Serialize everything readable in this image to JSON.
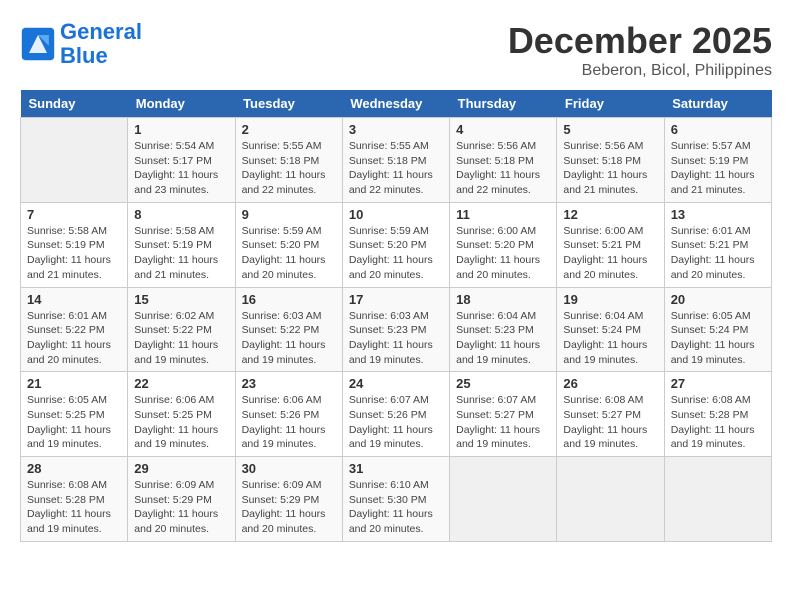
{
  "logo": {
    "line1": "General",
    "line2": "Blue"
  },
  "title": "December 2025",
  "location": "Beberon, Bicol, Philippines",
  "days_of_week": [
    "Sunday",
    "Monday",
    "Tuesday",
    "Wednesday",
    "Thursday",
    "Friday",
    "Saturday"
  ],
  "weeks": [
    [
      {
        "day": "",
        "sunrise": "",
        "sunset": "",
        "daylight": ""
      },
      {
        "day": "1",
        "sunrise": "5:54 AM",
        "sunset": "5:17 PM",
        "daylight": "11 hours and 23 minutes."
      },
      {
        "day": "2",
        "sunrise": "5:55 AM",
        "sunset": "5:18 PM",
        "daylight": "11 hours and 22 minutes."
      },
      {
        "day": "3",
        "sunrise": "5:55 AM",
        "sunset": "5:18 PM",
        "daylight": "11 hours and 22 minutes."
      },
      {
        "day": "4",
        "sunrise": "5:56 AM",
        "sunset": "5:18 PM",
        "daylight": "11 hours and 22 minutes."
      },
      {
        "day": "5",
        "sunrise": "5:56 AM",
        "sunset": "5:18 PM",
        "daylight": "11 hours and 21 minutes."
      },
      {
        "day": "6",
        "sunrise": "5:57 AM",
        "sunset": "5:19 PM",
        "daylight": "11 hours and 21 minutes."
      }
    ],
    [
      {
        "day": "7",
        "sunrise": "5:58 AM",
        "sunset": "5:19 PM",
        "daylight": "11 hours and 21 minutes."
      },
      {
        "day": "8",
        "sunrise": "5:58 AM",
        "sunset": "5:19 PM",
        "daylight": "11 hours and 21 minutes."
      },
      {
        "day": "9",
        "sunrise": "5:59 AM",
        "sunset": "5:20 PM",
        "daylight": "11 hours and 20 minutes."
      },
      {
        "day": "10",
        "sunrise": "5:59 AM",
        "sunset": "5:20 PM",
        "daylight": "11 hours and 20 minutes."
      },
      {
        "day": "11",
        "sunrise": "6:00 AM",
        "sunset": "5:20 PM",
        "daylight": "11 hours and 20 minutes."
      },
      {
        "day": "12",
        "sunrise": "6:00 AM",
        "sunset": "5:21 PM",
        "daylight": "11 hours and 20 minutes."
      },
      {
        "day": "13",
        "sunrise": "6:01 AM",
        "sunset": "5:21 PM",
        "daylight": "11 hours and 20 minutes."
      }
    ],
    [
      {
        "day": "14",
        "sunrise": "6:01 AM",
        "sunset": "5:22 PM",
        "daylight": "11 hours and 20 minutes."
      },
      {
        "day": "15",
        "sunrise": "6:02 AM",
        "sunset": "5:22 PM",
        "daylight": "11 hours and 19 minutes."
      },
      {
        "day": "16",
        "sunrise": "6:03 AM",
        "sunset": "5:22 PM",
        "daylight": "11 hours and 19 minutes."
      },
      {
        "day": "17",
        "sunrise": "6:03 AM",
        "sunset": "5:23 PM",
        "daylight": "11 hours and 19 minutes."
      },
      {
        "day": "18",
        "sunrise": "6:04 AM",
        "sunset": "5:23 PM",
        "daylight": "11 hours and 19 minutes."
      },
      {
        "day": "19",
        "sunrise": "6:04 AM",
        "sunset": "5:24 PM",
        "daylight": "11 hours and 19 minutes."
      },
      {
        "day": "20",
        "sunrise": "6:05 AM",
        "sunset": "5:24 PM",
        "daylight": "11 hours and 19 minutes."
      }
    ],
    [
      {
        "day": "21",
        "sunrise": "6:05 AM",
        "sunset": "5:25 PM",
        "daylight": "11 hours and 19 minutes."
      },
      {
        "day": "22",
        "sunrise": "6:06 AM",
        "sunset": "5:25 PM",
        "daylight": "11 hours and 19 minutes."
      },
      {
        "day": "23",
        "sunrise": "6:06 AM",
        "sunset": "5:26 PM",
        "daylight": "11 hours and 19 minutes."
      },
      {
        "day": "24",
        "sunrise": "6:07 AM",
        "sunset": "5:26 PM",
        "daylight": "11 hours and 19 minutes."
      },
      {
        "day": "25",
        "sunrise": "6:07 AM",
        "sunset": "5:27 PM",
        "daylight": "11 hours and 19 minutes."
      },
      {
        "day": "26",
        "sunrise": "6:08 AM",
        "sunset": "5:27 PM",
        "daylight": "11 hours and 19 minutes."
      },
      {
        "day": "27",
        "sunrise": "6:08 AM",
        "sunset": "5:28 PM",
        "daylight": "11 hours and 19 minutes."
      }
    ],
    [
      {
        "day": "28",
        "sunrise": "6:08 AM",
        "sunset": "5:28 PM",
        "daylight": "11 hours and 19 minutes."
      },
      {
        "day": "29",
        "sunrise": "6:09 AM",
        "sunset": "5:29 PM",
        "daylight": "11 hours and 20 minutes."
      },
      {
        "day": "30",
        "sunrise": "6:09 AM",
        "sunset": "5:29 PM",
        "daylight": "11 hours and 20 minutes."
      },
      {
        "day": "31",
        "sunrise": "6:10 AM",
        "sunset": "5:30 PM",
        "daylight": "11 hours and 20 minutes."
      },
      {
        "day": "",
        "sunrise": "",
        "sunset": "",
        "daylight": ""
      },
      {
        "day": "",
        "sunrise": "",
        "sunset": "",
        "daylight": ""
      },
      {
        "day": "",
        "sunrise": "",
        "sunset": "",
        "daylight": ""
      }
    ]
  ]
}
